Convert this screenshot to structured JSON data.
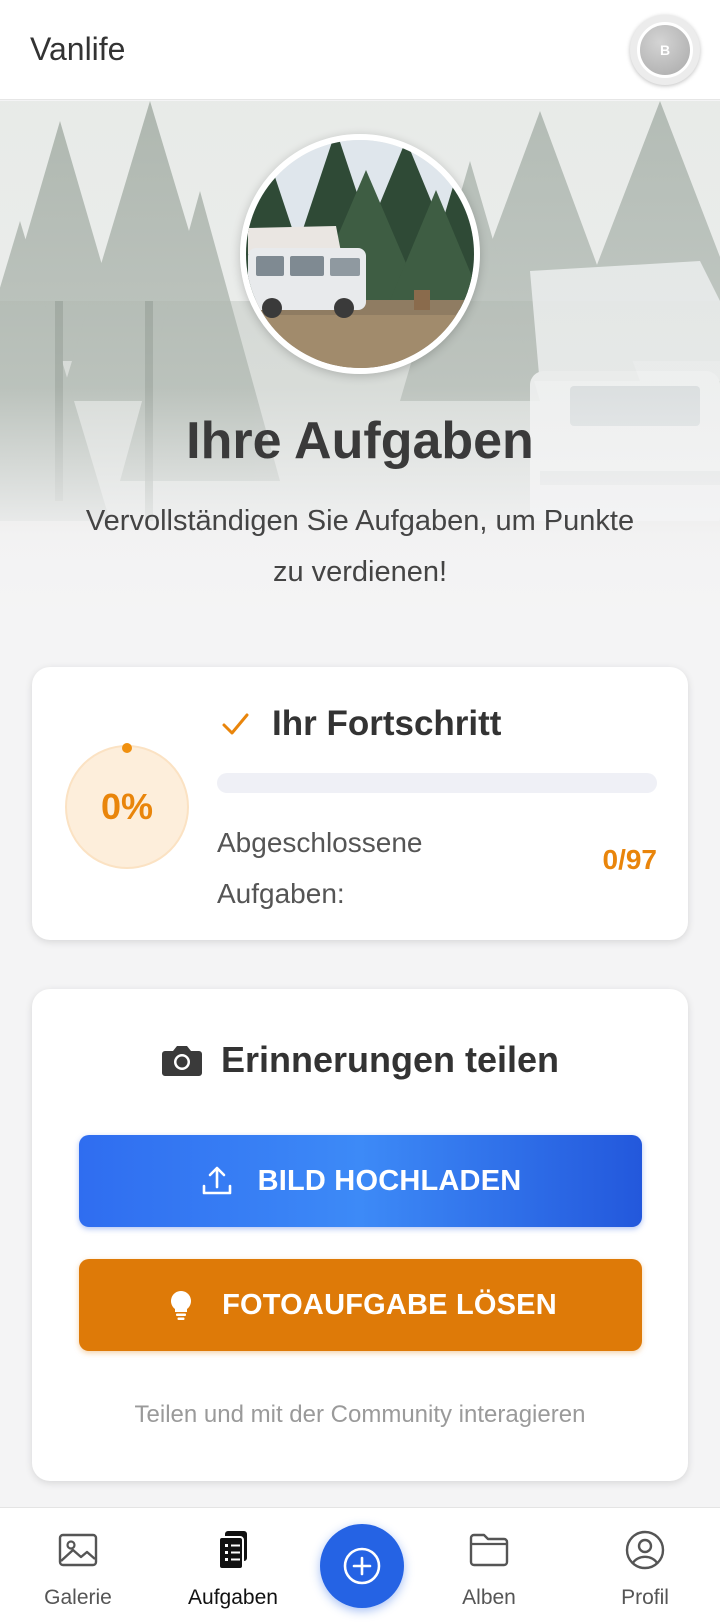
{
  "header": {
    "app_title": "Vanlife",
    "avatar_initial": "B"
  },
  "hero": {
    "title": "Ihre Aufgaben",
    "subtitle": "Vervollständigen Sie Aufgaben, um Punkte zu verdienen!"
  },
  "progress": {
    "title": "Ihr Fortschritt",
    "percent_label": "0%",
    "percent_value": 0,
    "completed_label": "Abgeschlossene Aufgaben:",
    "completed_count": "0/97",
    "accent_color": "#e9850b"
  },
  "share": {
    "title": "Erinnerungen teilen",
    "upload_button": "BILD HOCHLADEN",
    "photo_task_button": "FOTOAUFGABE LÖSEN",
    "footer_text": "Teilen und mit der Community interagieren",
    "upload_color": "#2f6df0",
    "photo_task_color": "#de7a08"
  },
  "nav": {
    "items": [
      {
        "label": "Galerie",
        "icon": "image-icon"
      },
      {
        "label": "Aufgaben",
        "icon": "clipboard-list-icon"
      },
      {
        "label": "",
        "icon": "plus-circle-icon"
      },
      {
        "label": "Alben",
        "icon": "folder-icon"
      },
      {
        "label": "Profil",
        "icon": "user-circle-icon"
      }
    ],
    "active": "Aufgaben",
    "fab_color": "#2563e4"
  }
}
